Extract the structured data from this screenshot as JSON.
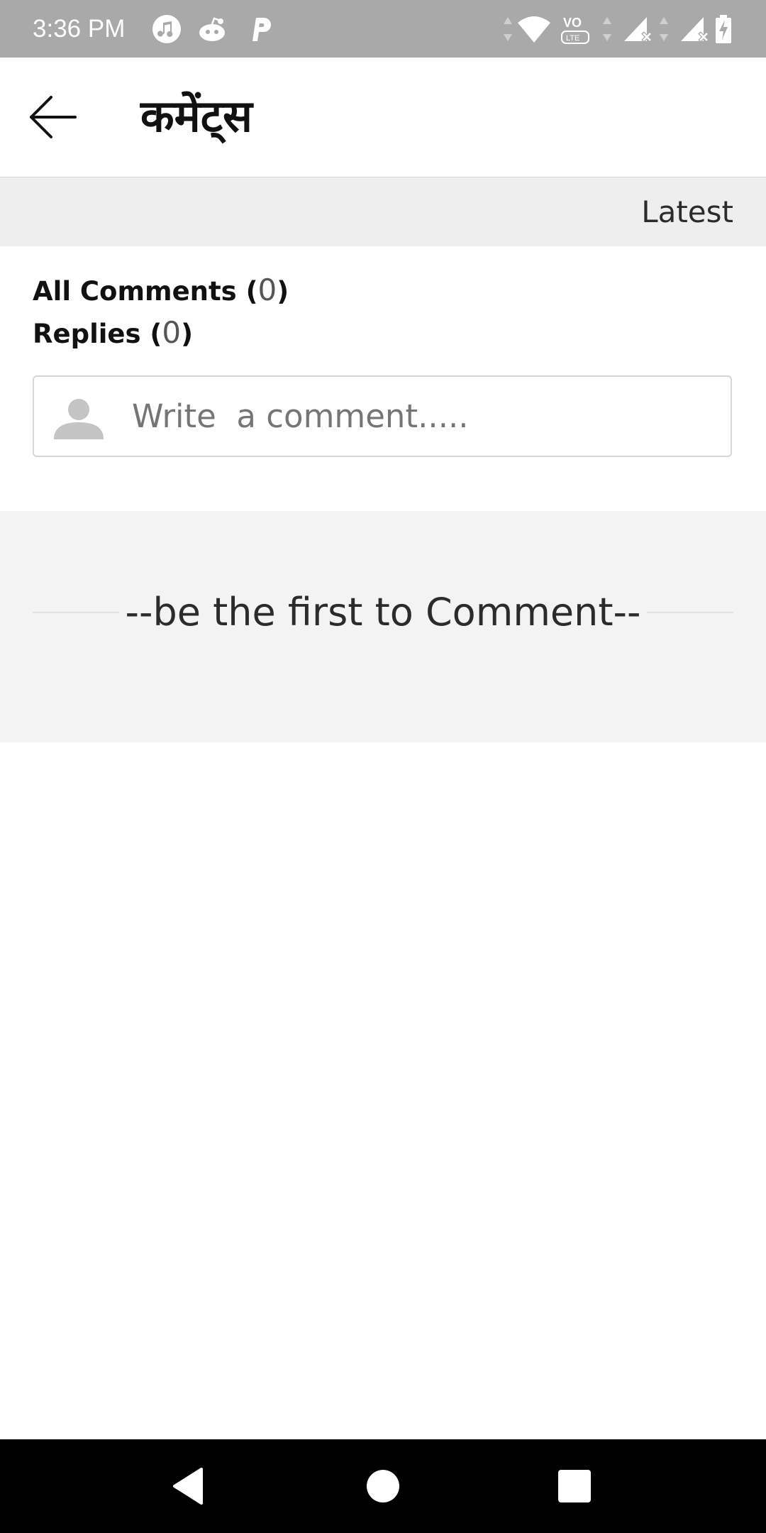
{
  "status_bar": {
    "time": "3:36 PM",
    "notification_icons": [
      "music-icon",
      "reddit-icon",
      "p-icon"
    ],
    "system_icons": [
      "data-arrows-icon",
      "wifi-icon",
      "volte-icon",
      "signal-x-icon",
      "signal-x-icon",
      "battery-charging-icon"
    ]
  },
  "header": {
    "title": "कमेंट्स",
    "back_icon": "arrow-left-icon"
  },
  "sort": {
    "label": "Latest"
  },
  "counts": {
    "all_comments_label": "All Comments (",
    "all_comments_value": "0",
    "replies_label": "Replies (",
    "replies_value": "0",
    "close_paren": ")"
  },
  "comment_input": {
    "placeholder": "Write  a comment.....",
    "value": ""
  },
  "empty_state": {
    "message": "--be the first to Comment--"
  },
  "nav_bar": {
    "icons": [
      "nav-back-icon",
      "nav-home-icon",
      "nav-recents-icon"
    ]
  },
  "colors": {
    "status_bar": "#a9a9a9",
    "sort_bar": "#eeeeee",
    "empty_panel": "#f3f3f3",
    "nav_bar": "#000000"
  }
}
